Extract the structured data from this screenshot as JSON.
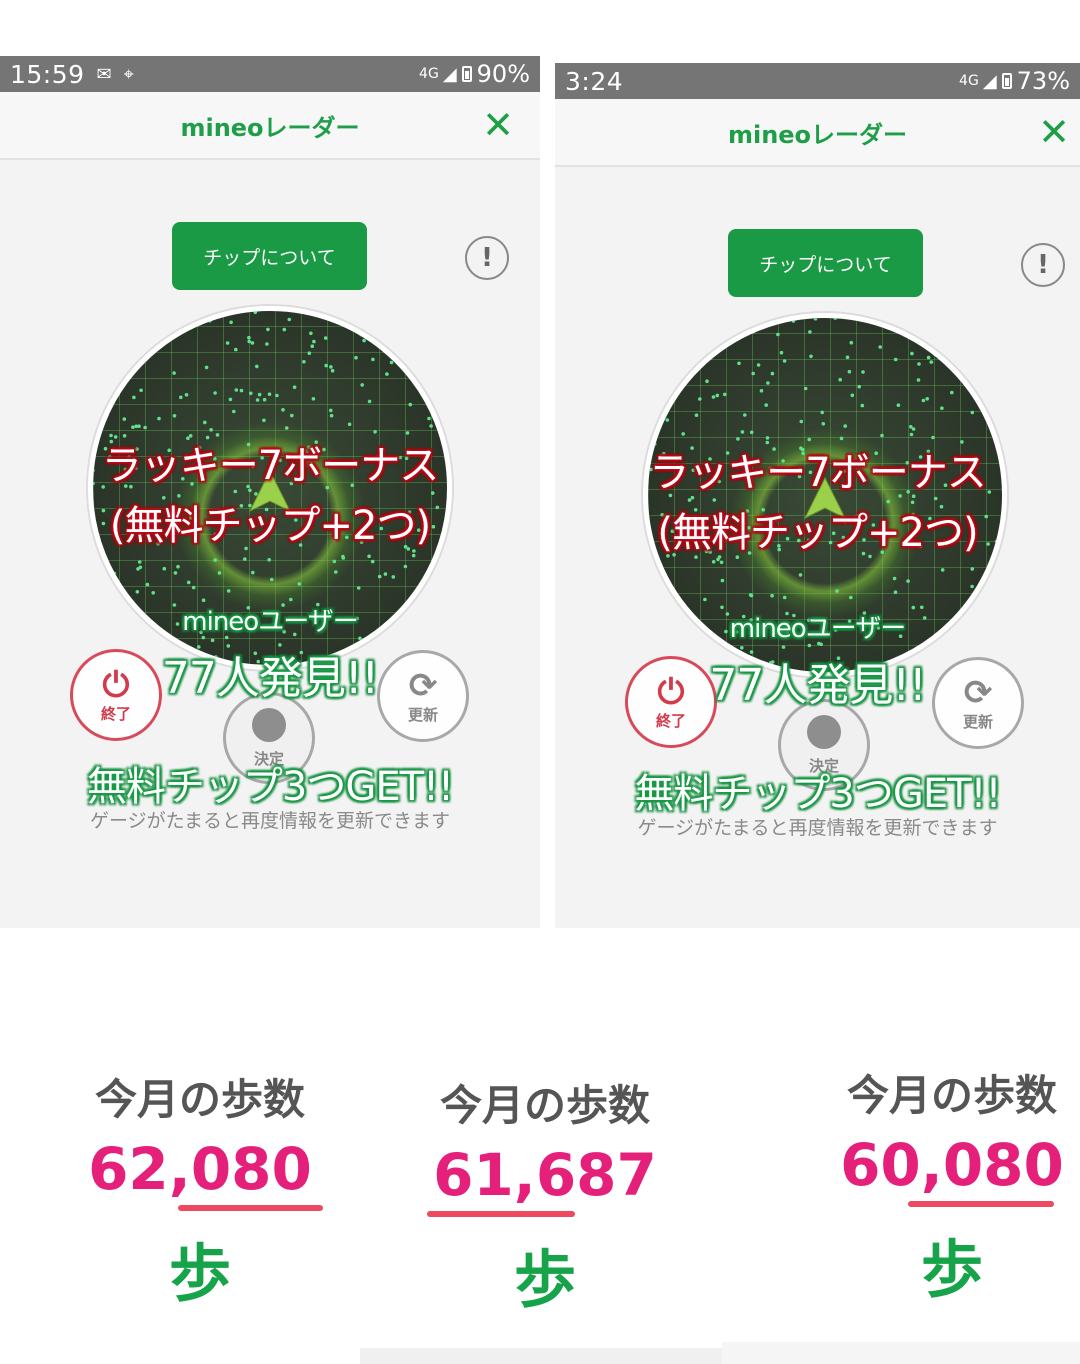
{
  "screens": [
    {
      "status": {
        "time": "15:59",
        "network": "4G",
        "battery": "90%"
      },
      "appbar": {
        "title": "mineoレーダー",
        "close": "✕"
      },
      "chip_button": "チップについて",
      "info_button": "!",
      "bonus_line1": "ラッキー7ボーナス",
      "bonus_line2": "(無料チップ+2つ)",
      "users_label": "mineoユーザー",
      "found": "77人発見!!",
      "free_chips": "無料チップ3つGET!!",
      "hint": "ゲージがたまると再度情報を更新できます",
      "buttons": {
        "end": "終了",
        "decide": "決定",
        "update": "更新"
      }
    },
    {
      "status": {
        "time": "3:24",
        "network": "4G",
        "battery": "73%"
      },
      "appbar": {
        "title": "mineoレーダー",
        "close": "✕"
      },
      "chip_button": "チップについて",
      "info_button": "!",
      "bonus_line1": "ラッキー7ボーナス",
      "bonus_line2": "(無料チップ+2つ)",
      "users_label": "mineoユーザー",
      "found": "77人発見!!",
      "free_chips": "無料チップ3つGET!!",
      "hint": "ゲージがたまると再度情報を更新できます",
      "buttons": {
        "end": "終了",
        "decide": "決定",
        "update": "更新"
      }
    }
  ],
  "steps": [
    {
      "label": "今月の歩数",
      "value": "62,080",
      "unit": "歩"
    },
    {
      "label": "今月の歩数",
      "value": "61,687",
      "unit": "歩"
    },
    {
      "label": "今月の歩数",
      "value": "60,080",
      "unit": "歩"
    }
  ],
  "colors": {
    "brand_green": "#1f9e48",
    "step_pink": "#e5207a",
    "underline_red": "#ee4a5f",
    "end_red": "#d33a4c"
  }
}
